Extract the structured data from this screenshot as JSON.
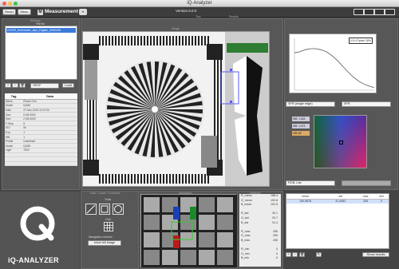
{
  "window": {
    "title": "iQ-Analyzer"
  },
  "toolbar": {
    "reset_label": "Reset",
    "menu_label": "Menu",
    "mode_icon": "M",
    "mode_label": "Measurement",
    "mode_chevron": "▾",
    "version": "Version 6.0.0"
  },
  "headers": {
    "file_list": "File list",
    "settings": "Settings",
    "image": "Image",
    "tool": "Tool",
    "results": "Results",
    "tools": "Tools / Guide / Comment",
    "navigation": "Navigation",
    "statistics": "Statistics"
  },
  "file_list": {
    "items": [
      "OCHR_Schneider_Apo_Digitar_4052430"
    ]
  },
  "file_controls": {
    "add": "+",
    "remove": "−",
    "trash_icon": "trash-icon",
    "profile_value": "OECF",
    "load_label": "Load"
  },
  "tag_table": {
    "headers": [
      "Tag",
      "Data"
    ],
    "rows": [
      [
        "Name",
        "Phase One"
      ],
      [
        "Model",
        "IQ180"
      ],
      [
        "Date",
        "27-Nov-2013 12:07:00"
      ],
      [
        "Size",
        "5 KB 6000"
      ],
      [
        "Size",
        "2 KB 6000"
      ],
      [
        "F-Stop",
        "5"
      ],
      [
        "ISO",
        "50"
      ],
      [
        "Exp",
        "1"
      ],
      [
        "WB",
        "1"
      ],
      [
        "Profile",
        "Undefined"
      ],
      [
        "Model",
        "IQ180"
      ],
      [
        "Light",
        "7000"
      ],
      [
        "",
        ""
      ],
      [
        "",
        ""
      ],
      [
        "",
        ""
      ]
    ]
  },
  "logo": {
    "brand": "iQ-ANALYZER"
  },
  "chart": {
    "legend": "0.5 LP/pixel 18%",
    "select_left": "SFR (single edge)",
    "select_right": "SFR"
  },
  "color_panel": {
    "labels": [
      "WB: 1.618",
      "WB: 1.573",
      "WB diff"
    ]
  },
  "stats": {
    "selector_left": "RGB, Lab",
    "headers": [
      "",
      "mean",
      "std",
      "max",
      "min"
    ],
    "rows": [
      [
        "",
        "190.8878",
        "31.4082",
        "255",
        "0"
      ]
    ],
    "show_results": "Show results"
  },
  "tool_panel": {
    "tools_label": "Tools",
    "grid_label": "Grid",
    "nav_label": "Navigation controls",
    "show_full_image": "show full image"
  },
  "stats_list": [
    [
      "R_mean",
      "188.4"
    ],
    [
      "G_mean",
      "192.8"
    ],
    [
      "B_mean",
      "191.5"
    ],
    [
      "",
      ""
    ],
    [
      "R_std",
      "30.1"
    ],
    [
      "G_std",
      "29.7"
    ],
    [
      "B_std",
      "31.4"
    ],
    [
      "",
      ""
    ],
    [
      "R_max",
      "255"
    ],
    [
      "G_max",
      "255"
    ],
    [
      "B_max",
      "255"
    ],
    [
      "",
      ""
    ],
    [
      "R_min",
      "0"
    ],
    [
      "G_min",
      "0"
    ],
    [
      "B_min",
      "0"
    ]
  ],
  "colors": {
    "selection_blue": "#3a7ad9",
    "panel_bg": "#575757",
    "chart_curve": "#555555",
    "green_box": "#2e7d32"
  },
  "chart_data": {
    "type": "line",
    "title": "",
    "xlabel": "",
    "ylabel": "",
    "series": [
      {
        "values": [
          0.72,
          0.74,
          0.78,
          0.8,
          0.8,
          0.78,
          0.74,
          0.67,
          0.58,
          0.47,
          0.36,
          0.26,
          0.18,
          0.12,
          0.08,
          0.05
        ]
      }
    ],
    "ylim": [
      0,
      1
    ],
    "grid": false,
    "legend": "top-right"
  }
}
